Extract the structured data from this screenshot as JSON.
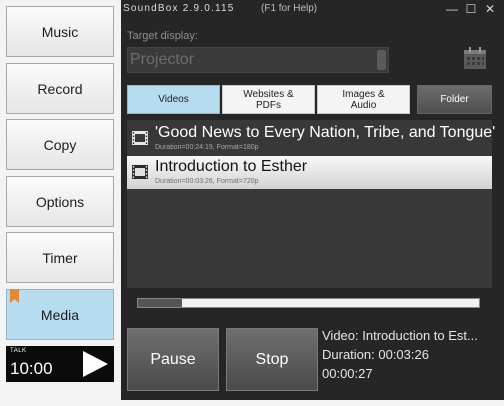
{
  "nav": {
    "items": [
      {
        "label": "Music",
        "active": false
      },
      {
        "label": "Record",
        "active": false
      },
      {
        "label": "Copy",
        "active": false
      },
      {
        "label": "Options",
        "active": false
      },
      {
        "label": "Timer",
        "active": false
      },
      {
        "label": "Media",
        "active": true
      }
    ]
  },
  "talk": {
    "label": "TALK",
    "time": "10:00"
  },
  "window": {
    "title": "SoundBox 2.9.0.115",
    "help": "(F1 for Help)",
    "controls": [
      "minimize",
      "maximize",
      "close"
    ]
  },
  "target": {
    "label": "Target display:",
    "value": "Projector"
  },
  "tabs": [
    {
      "label": "Videos",
      "active": true
    },
    {
      "label": "Websites & PDFs",
      "active": false
    },
    {
      "label": "Images & Audio",
      "active": false
    },
    {
      "label": "Folder",
      "active": false
    }
  ],
  "media_list": [
    {
      "title": "'Good News to Every Nation, Tribe, and Tongue'",
      "meta": "Duration=00:24:19, Format=180p",
      "selected": false
    },
    {
      "title": "Introduction to Esther",
      "meta": "Duration=00:03:26, Format=720p",
      "selected": true
    }
  ],
  "progress": {
    "fraction": 0.13
  },
  "buttons": {
    "pause": "Pause",
    "stop": "Stop"
  },
  "status": {
    "video": "Video: Introduction to Est...",
    "duration": "Duration: 00:03:26",
    "elapsed": "00:00:27"
  },
  "colors": {
    "panel_bg": "#262626",
    "active_blue": "#b7dcf0",
    "bookmark_orange": "#e08a3a"
  }
}
